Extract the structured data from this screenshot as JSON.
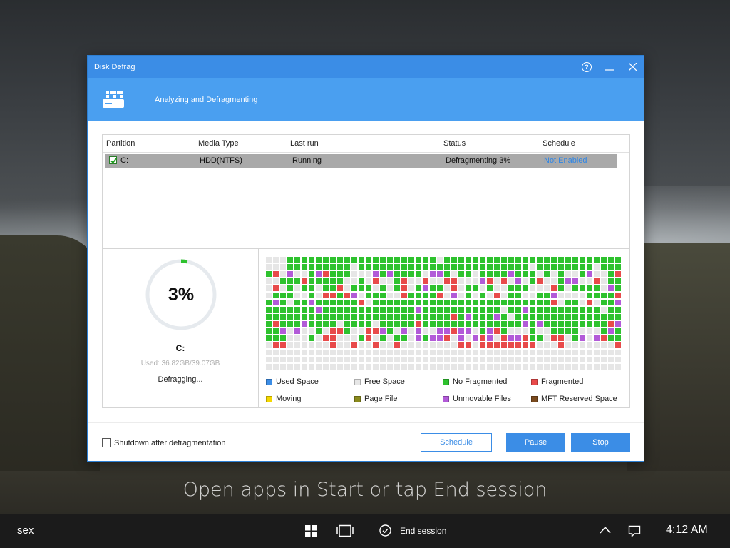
{
  "window": {
    "title": "Disk Defrag",
    "banner": "Analyzing and Defragmenting",
    "help_icon": "?"
  },
  "table": {
    "headers": [
      "Partition",
      "Media Type",
      "Last run",
      "Status",
      "Schedule"
    ],
    "rows": [
      {
        "checked": true,
        "partition": "C:",
        "media": "HDD(NTFS)",
        "last_run": "Running",
        "status": "Defragmenting 3%",
        "schedule": "Not Enabled"
      }
    ]
  },
  "progress": {
    "percent_label": "3%",
    "fraction": 0.03,
    "drive": "C:",
    "used": "Used: 36.82GB/39.07GB",
    "state": "Defragging..."
  },
  "legend": [
    {
      "label": "Used Space",
      "color": "#3b8de6"
    },
    {
      "label": "Free Space",
      "color": "#e6e6e6"
    },
    {
      "label": "No Fragmented",
      "color": "#2ec22e"
    },
    {
      "label": "Fragmented",
      "color": "#e84a4a"
    },
    {
      "label": "Moving",
      "color": "#f5d800"
    },
    {
      "label": "Page File",
      "color": "#8a8a1c"
    },
    {
      "label": "Unmovable Files",
      "color": "#b25ad8"
    },
    {
      "label": "MFT Reserved Space",
      "color": "#7a4a1e"
    }
  ],
  "footer": {
    "shutdown_label": "Shutdown after defragmentation",
    "schedule_button": "Schedule",
    "pause_button": "Pause",
    "stop_button": "Stop"
  },
  "overlay": "Open apps in Start or tap End session",
  "taskbar": {
    "user": "sex",
    "end_session": "End session",
    "time": "4:12 AM"
  }
}
